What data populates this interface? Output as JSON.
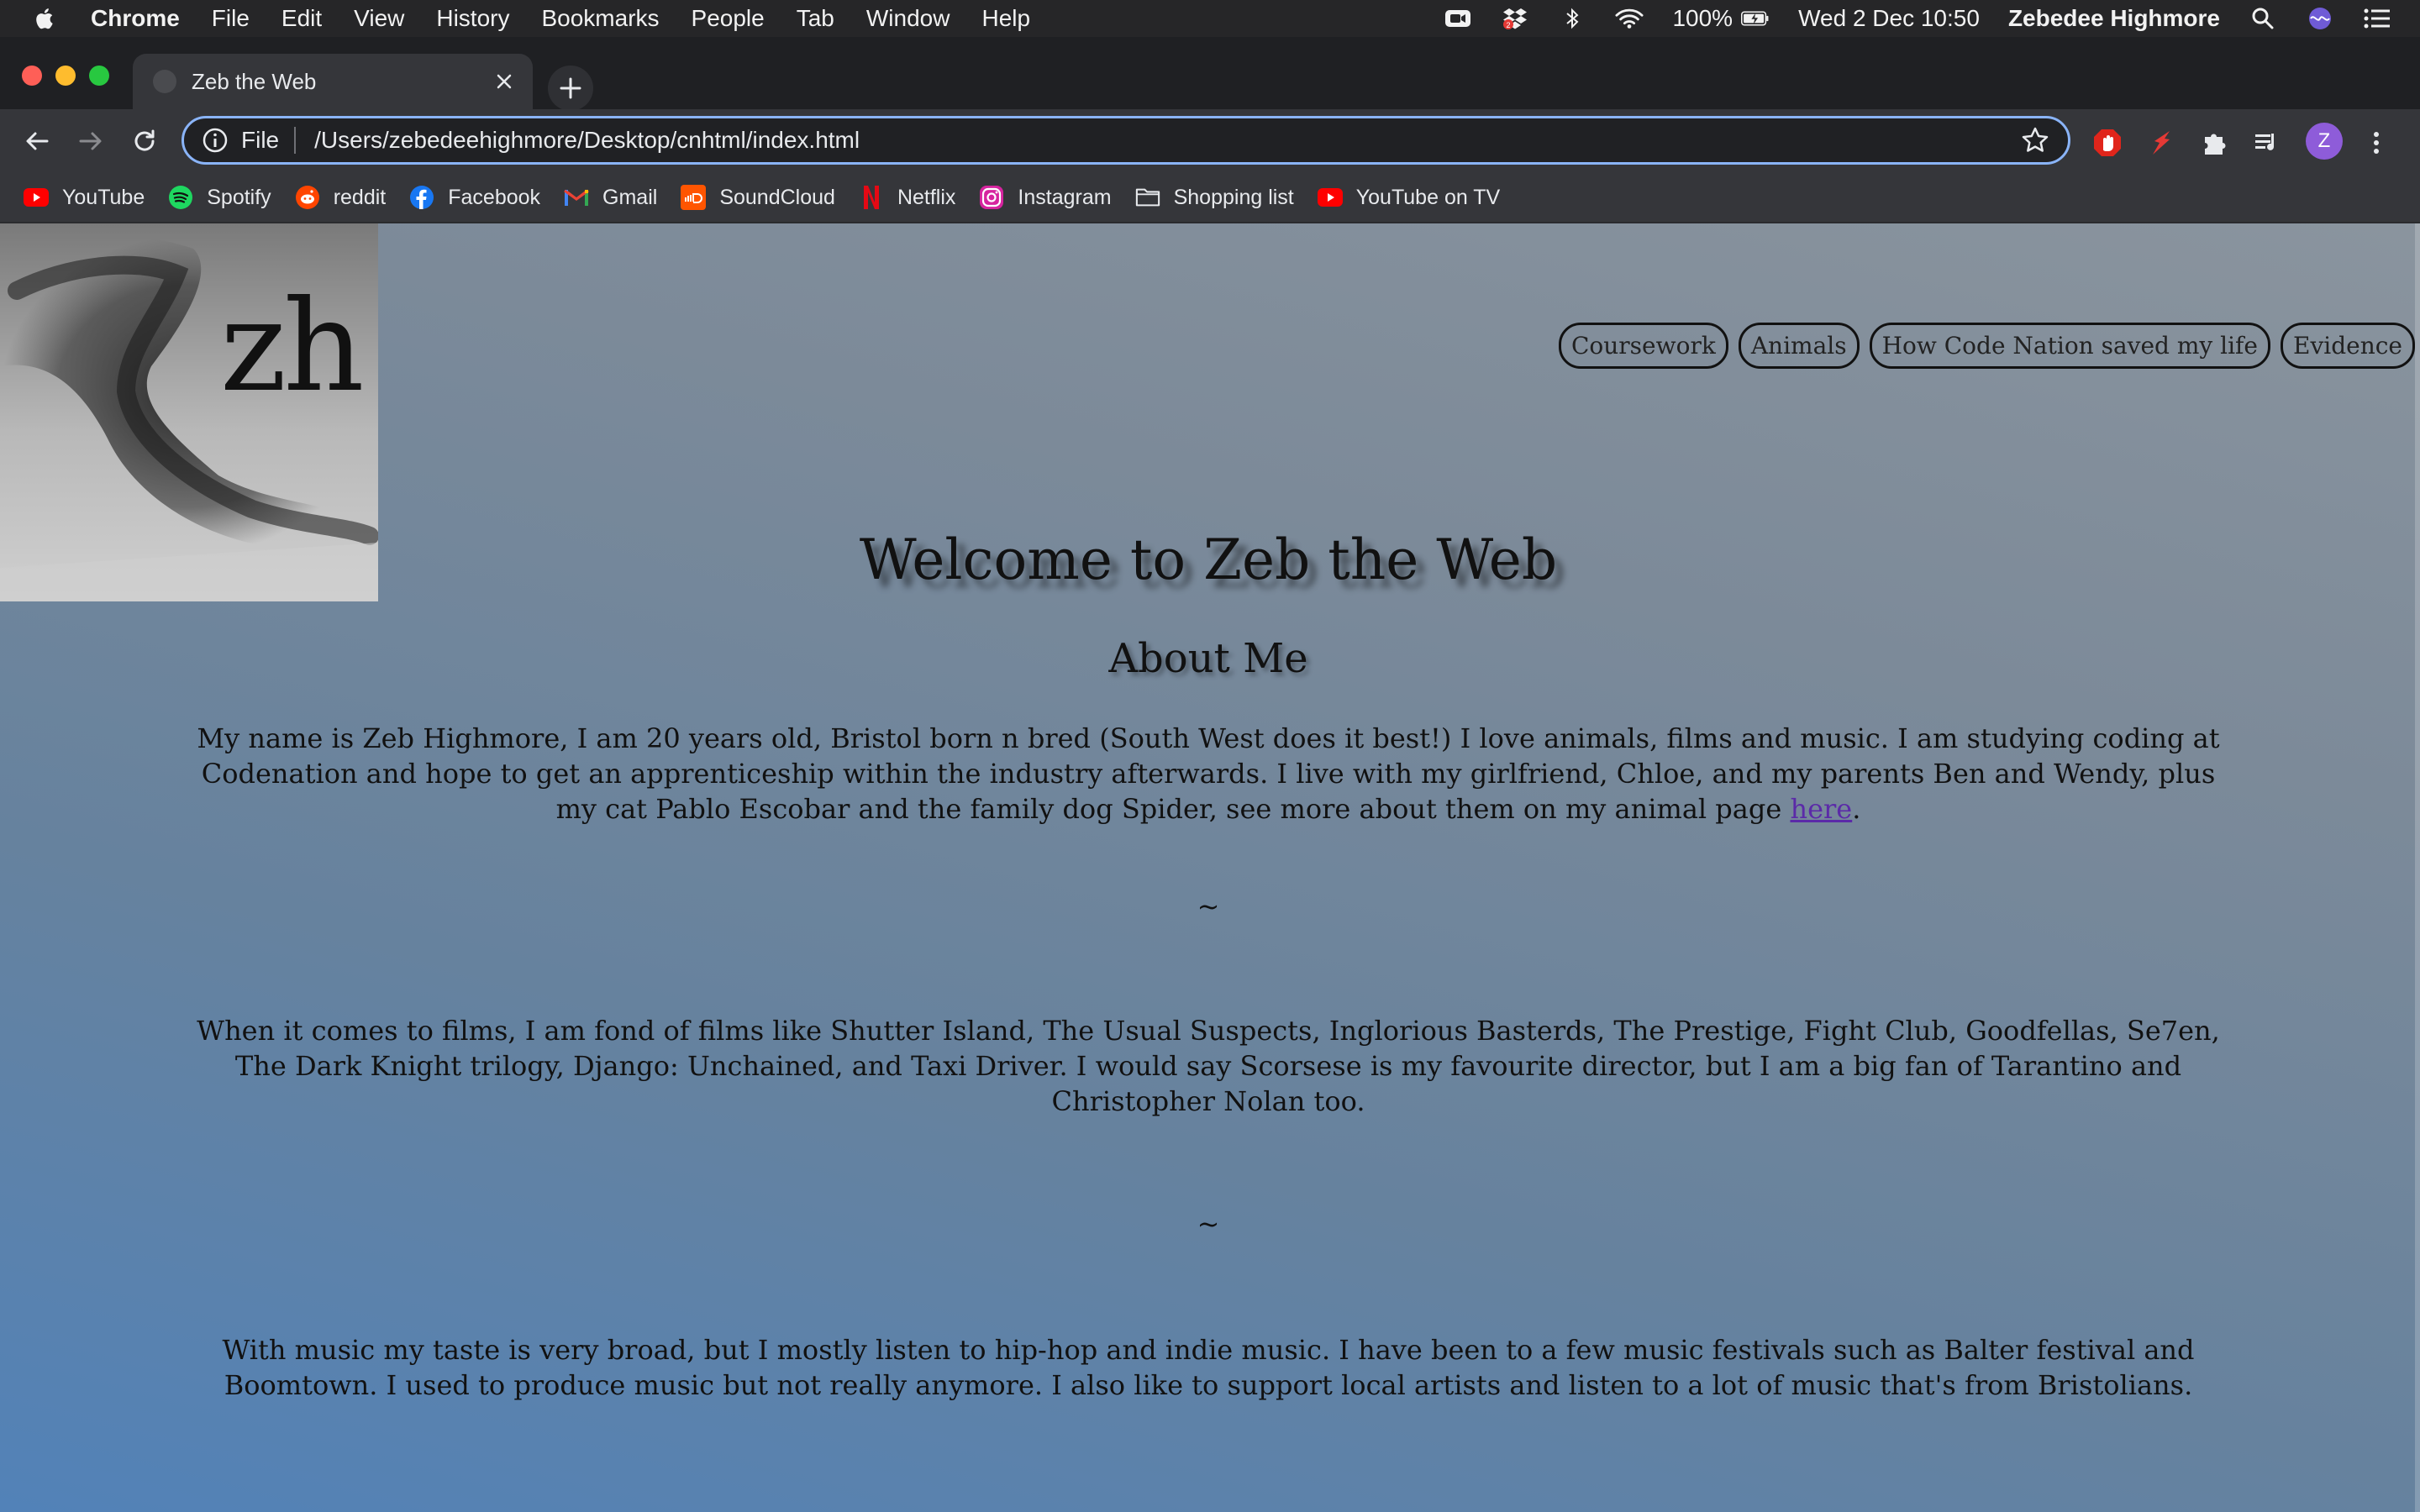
{
  "menubar": {
    "app": "Chrome",
    "items": [
      "File",
      "Edit",
      "View",
      "History",
      "Bookmarks",
      "People",
      "Tab",
      "Window",
      "Help"
    ],
    "battery": "100%",
    "datetime": "Wed 2 Dec  10:50",
    "user": "Zebedee Highmore"
  },
  "tab": {
    "title": "Zeb the Web"
  },
  "omnibox": {
    "scheme": "File",
    "url": "/Users/zebedeehighmore/Desktop/cnhtml/index.html"
  },
  "profile": {
    "initial": "Z"
  },
  "bookmarks": [
    {
      "label": "YouTube",
      "icon": "youtube-icon"
    },
    {
      "label": "Spotify",
      "icon": "spotify-icon"
    },
    {
      "label": "reddit",
      "icon": "reddit-icon"
    },
    {
      "label": "Facebook",
      "icon": "facebook-icon"
    },
    {
      "label": "Gmail",
      "icon": "gmail-icon"
    },
    {
      "label": "SoundCloud",
      "icon": "soundcloud-icon"
    },
    {
      "label": "Netflix",
      "icon": "netflix-icon"
    },
    {
      "label": "Instagram",
      "icon": "instagram-icon"
    },
    {
      "label": "Shopping list",
      "icon": "folder-icon"
    },
    {
      "label": "YouTube on TV",
      "icon": "youtube-icon"
    }
  ],
  "page": {
    "logo_text": "zh",
    "nav": [
      "Coursework",
      "Animals",
      "How Code Nation saved my life",
      "Evidence"
    ],
    "heading": "Welcome to Zeb the Web",
    "subheading": "About Me",
    "p1_before": "My name is Zeb Highmore, I am 20 years old, Bristol born n bred (South West does it best!) I love animals, films and music. I am studying coding at Codenation and hope to get an apprenticeship within the industry afterwards. I live with my girlfriend, Chloe, and my parents Ben and Wendy, plus my cat Pablo Escobar and the family dog Spider, see more about them on my animal page ",
    "p1_link": "here",
    "p1_after": ".",
    "separator": "~",
    "p2": "When it comes to films, I am fond of films like Shutter Island, The Usual Suspects, Inglorious Basterds, The Prestige, Fight Club, Goodfellas, Se7en, The Dark Knight trilogy, Django: Unchained, and Taxi Driver. I would say Scorsese is my favourite director, but I am a big fan of Tarantino and Christopher Nolan too.",
    "p3": "With music my taste is very broad, but I mostly listen to hip-hop and indie music. I have been to a few music festivals such as Balter festival and Boomtown. I used to produce music but not really anymore. I also like to support local artists and listen to a lot of music that's from Bristolians."
  },
  "colors": {
    "omnibox_focus": "#8ab4f8",
    "link": "#5b2aa8",
    "page_top": "#8a949e",
    "page_bottom": "#5282b8"
  }
}
